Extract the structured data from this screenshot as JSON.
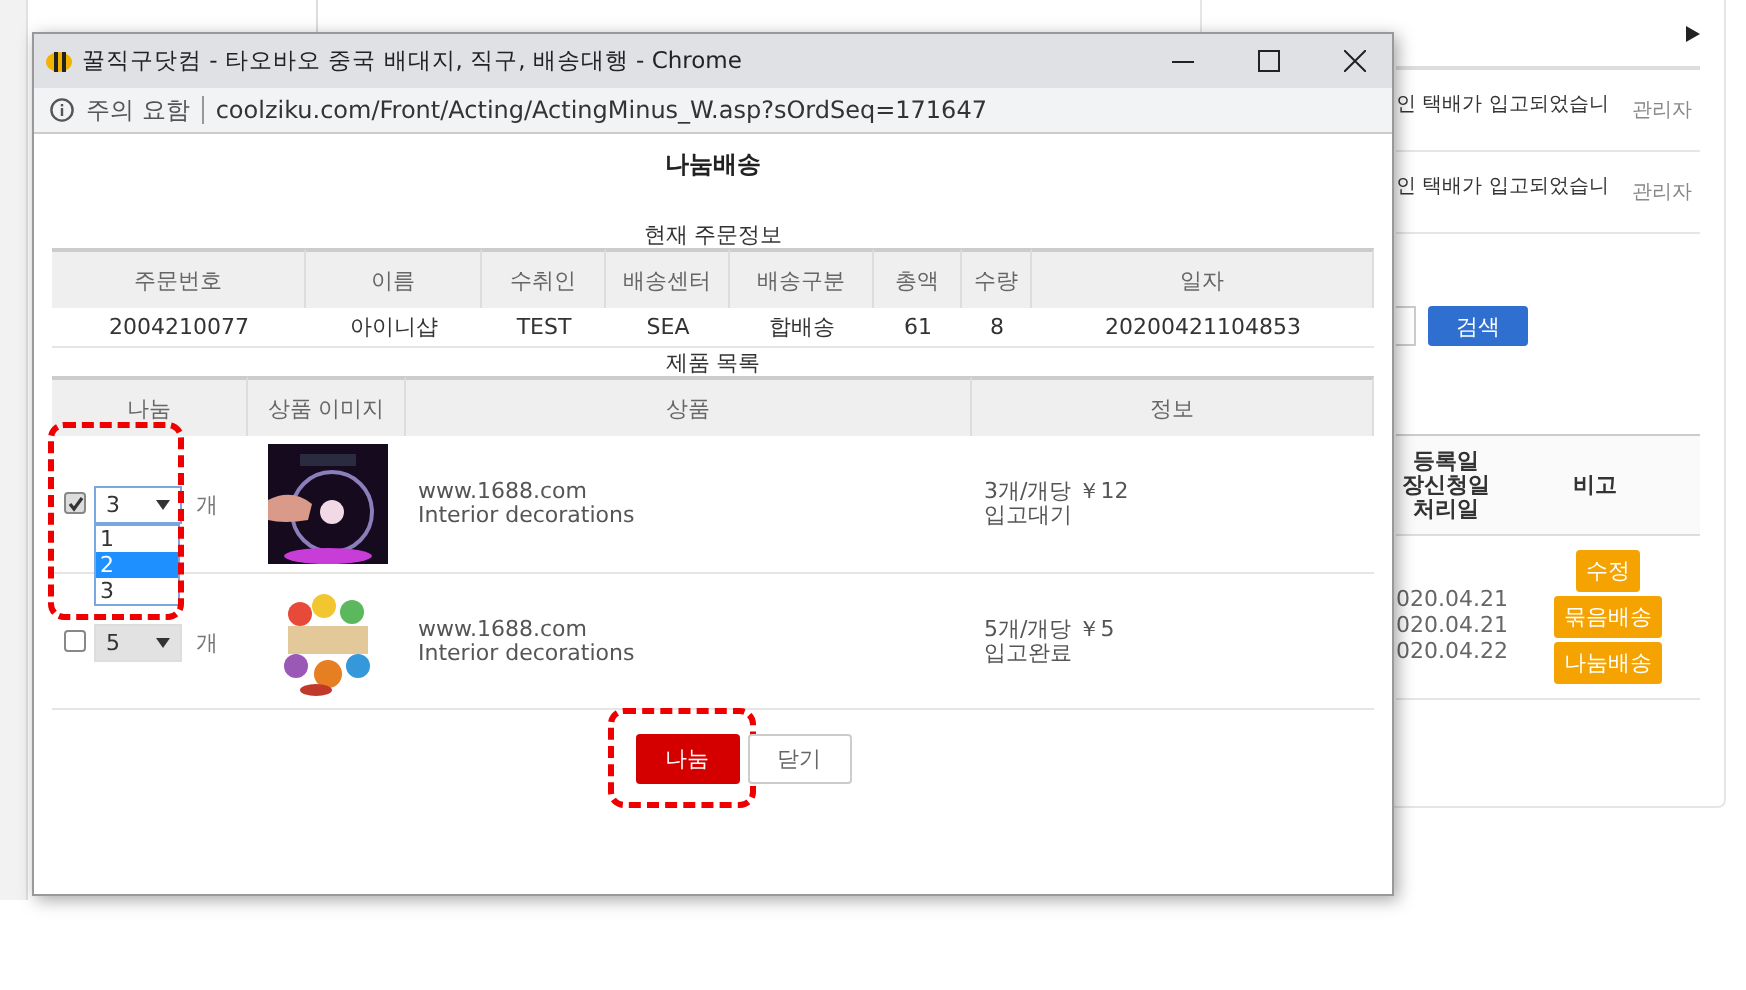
{
  "background_page": {
    "notices": [
      {
        "text": "인 택배가 입고되었습니",
        "author": "관리자"
      },
      {
        "text": "인 택배가 입고되었습니",
        "author": "관리자"
      }
    ],
    "search_button": "검색",
    "table": {
      "columns": [
        {
          "lines": [
            "등록일",
            "장신청일",
            "처리일"
          ]
        },
        {
          "lines": [
            "비고"
          ]
        }
      ],
      "dates": [
        "020.04.21",
        "020.04.21",
        "020.04.22"
      ],
      "actions": [
        "수정",
        "묶음배송",
        "나눔배송"
      ]
    }
  },
  "popup": {
    "window_title": "꿀직구닷컴 - 타오바오 중국 배대지, 직구, 배송대행 - Chrome",
    "security_label": "주의 요함",
    "url": "coolziku.com/Front/Acting/ActingMinus_W.asp?sOrdSeq=171647",
    "heading": "나눔배송",
    "order_caption": "현재 주문정보",
    "order_table": {
      "columns": [
        "주문번호",
        "이름",
        "수취인",
        "배송센터",
        "배송구분",
        "총액",
        "수량",
        "일자"
      ],
      "row": [
        "2004210077",
        "아이니샵",
        "TEST",
        "SEA",
        "합배송",
        "61",
        "8",
        "20200421104853"
      ]
    },
    "product_caption": "제품 목록",
    "product_table": {
      "columns": [
        "나눔",
        "상품 이미지",
        "상품",
        "정보"
      ],
      "rows": [
        {
          "checked": true,
          "quantity": "3",
          "unit": "개",
          "disabled": false,
          "highlighted": true,
          "expanded": true,
          "options": [
            {
              "label": "1",
              "selected": false
            },
            {
              "label": "2",
              "selected": true
            },
            {
              "label": "3",
              "selected": false
            }
          ],
          "image": {
            "kind": "picture"
          },
          "site": "www.1688.com",
          "name": "Interior decorations",
          "info": "3개/개당 ￥12",
          "status": "입고대기"
        },
        {
          "checked": false,
          "quantity": "5",
          "unit": "개",
          "disabled": true,
          "highlighted": false,
          "expanded": false,
          "image": {
            "kind": "picture"
          },
          "site": "www.1688.com",
          "name": "Interior decorations",
          "info": "5개/개당 ￥5",
          "status": "입고완료"
        }
      ]
    },
    "buttons": [
      {
        "label": "나눔",
        "kind": "primary",
        "highlighted": true
      },
      {
        "label": "닫기",
        "kind": "secondary",
        "highlighted": false
      }
    ]
  }
}
